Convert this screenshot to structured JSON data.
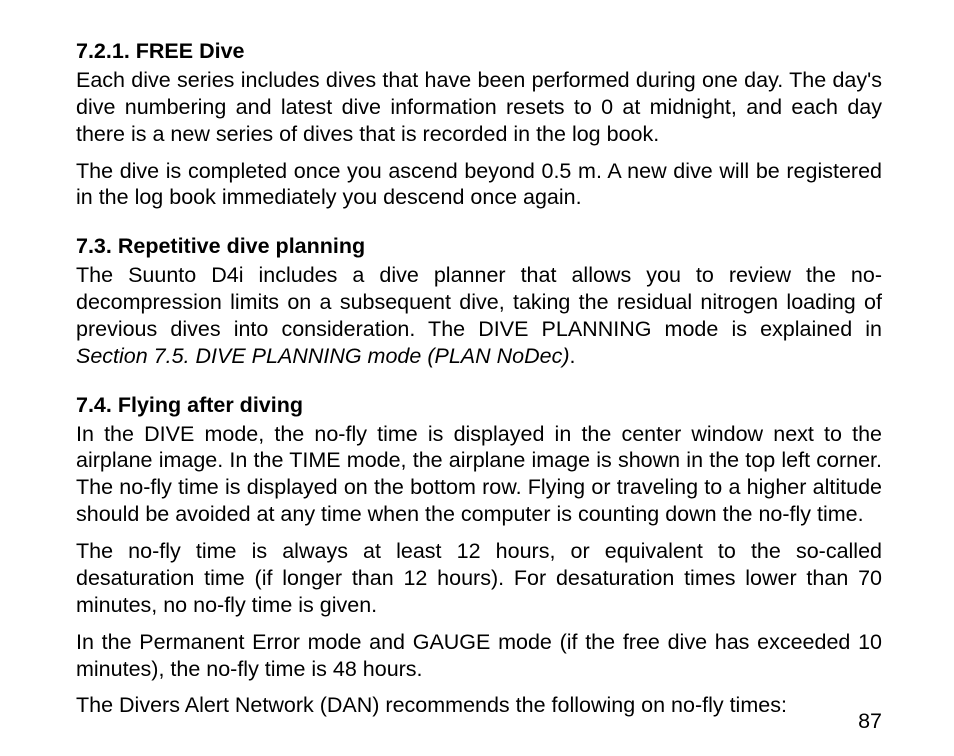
{
  "sections": {
    "s1": {
      "heading": "7.2.1. FREE Dive",
      "p1": "Each dive series includes dives that have been performed during one day. The day's dive numbering and latest dive information resets to 0 at midnight, and each day there is a new series of dives that is recorded in the log book.",
      "p2": "The dive is completed once you ascend beyond 0.5 m. A new dive will be registered in the log book immediately you descend once again."
    },
    "s2": {
      "heading": "7.3. Repetitive dive planning",
      "p1_a": "The Suunto D4i includes a dive planner that allows you to review the no-decompression limits on a subsequent dive, taking the residual nitrogen loading of previous dives into consideration. The DIVE PLANNING mode is explained in ",
      "p1_i": "Section 7.5. DIVE PLANNING mode (PLAN NoDec)",
      "p1_b": "."
    },
    "s3": {
      "heading": "7.4. Flying after diving",
      "p1": "In the DIVE mode, the no-fly time is displayed in the center window next to the airplane image. In the TIME mode, the airplane image is shown in the top left corner. The no-fly time is displayed on the bottom row. Flying or traveling to a higher altitude should be avoided at any time when the computer is counting down the no-fly time.",
      "p2": "The no-fly time is always at least 12 hours, or equivalent to the so-called desaturation time (if longer than 12 hours). For desaturation times lower than 70 minutes, no no-fly time is given.",
      "p3": "In the Permanent Error mode and GAUGE mode (if the free dive has exceeded 10 minutes), the no-fly time is 48 hours.",
      "p4": "The Divers Alert Network (DAN) recommends the following on no-fly times:"
    }
  },
  "page_number": "87"
}
